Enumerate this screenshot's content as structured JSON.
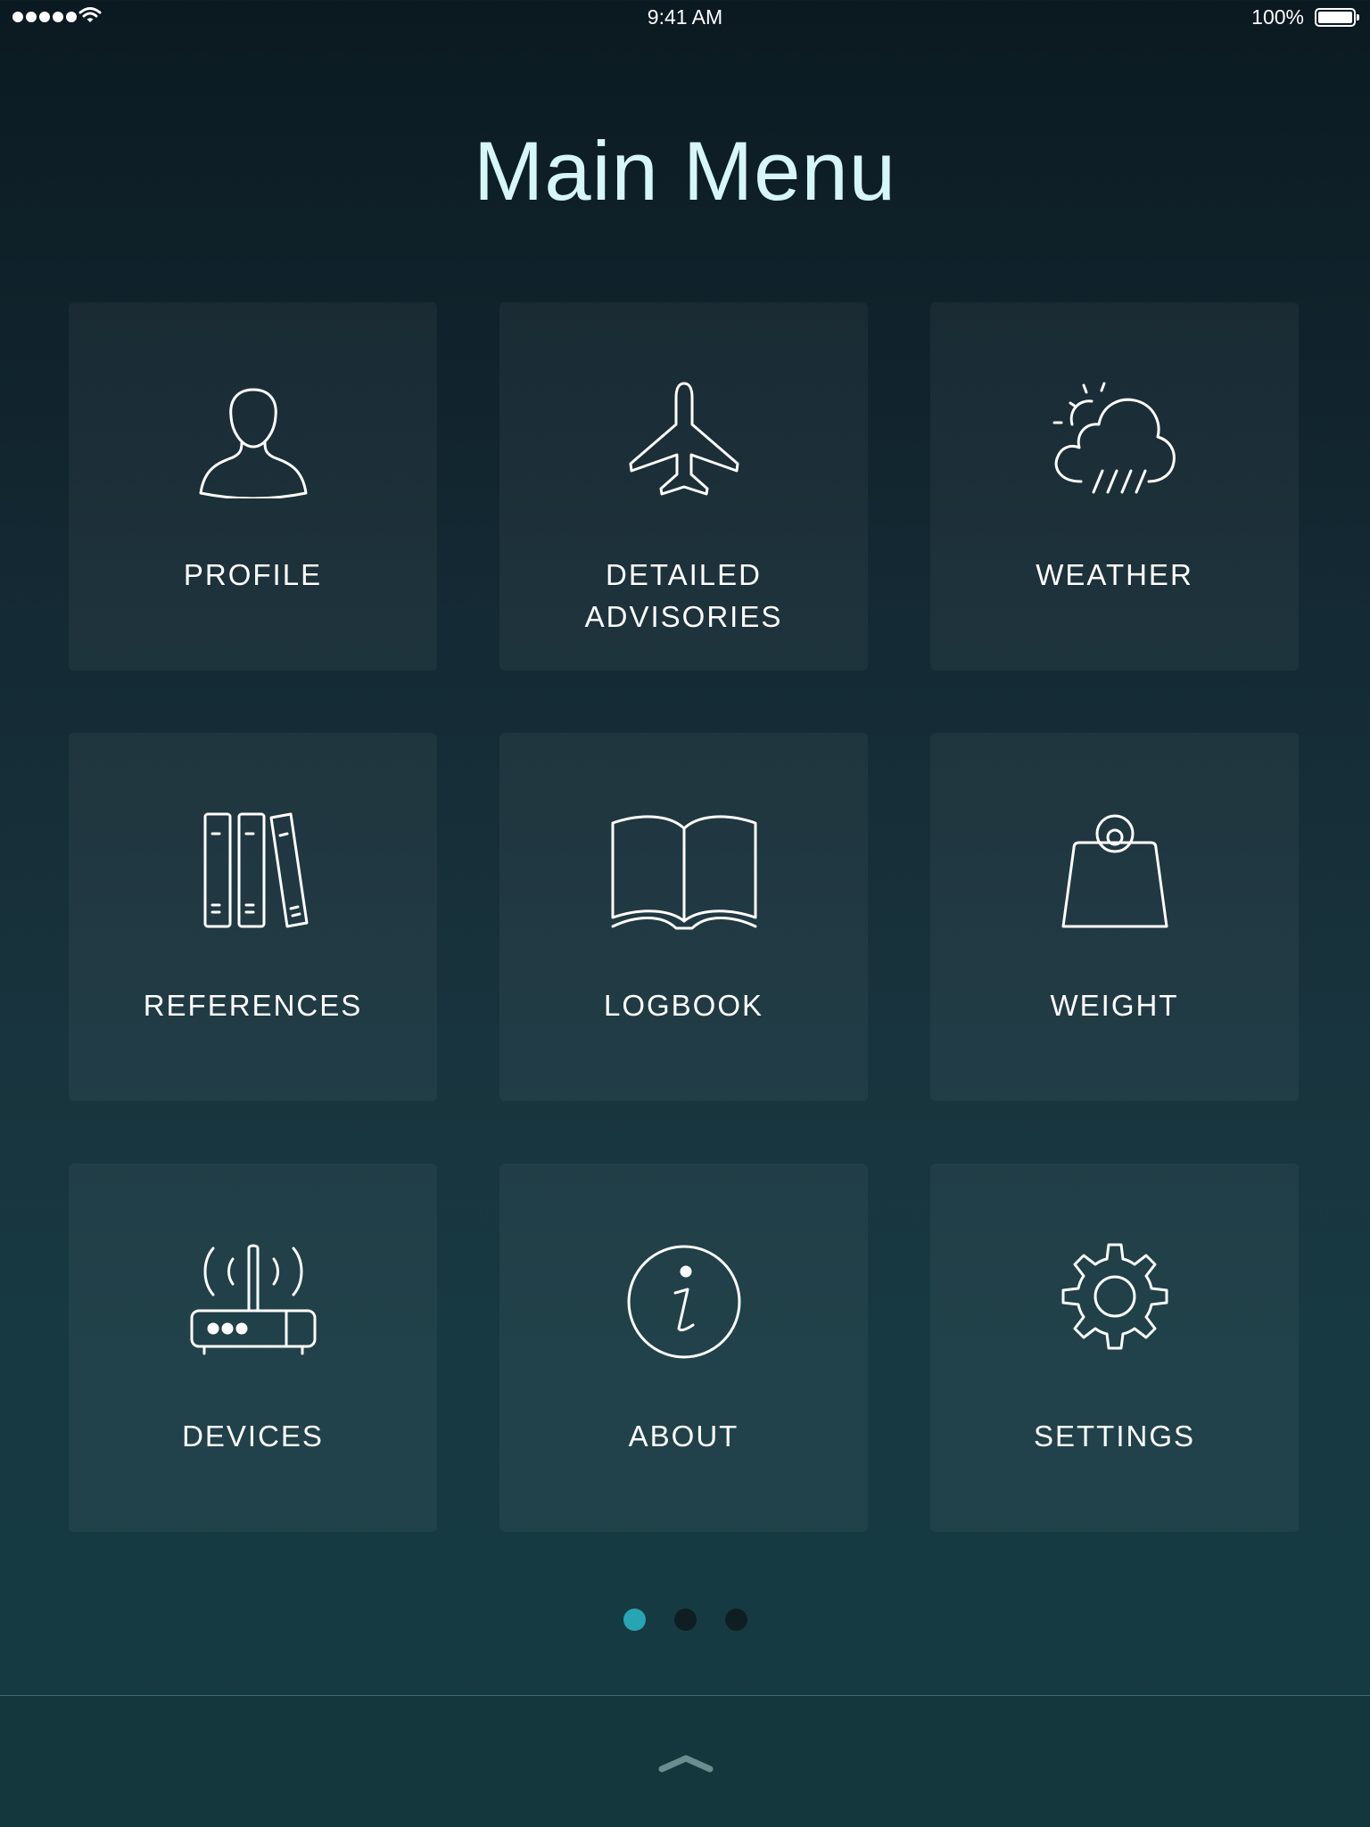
{
  "status_bar": {
    "time": "9:41 AM",
    "battery": "100%",
    "icons": [
      "signal-dots-icon",
      "wifi-icon",
      "battery-icon"
    ]
  },
  "title": "Main Menu",
  "menu": [
    {
      "label": "PROFILE",
      "icon": "person-icon"
    },
    {
      "label": "DETAILED\nADVISORIES",
      "icon": "airplane-icon"
    },
    {
      "label": "WEATHER",
      "icon": "weather-icon"
    },
    {
      "label": "REFERENCES",
      "icon": "books-icon"
    },
    {
      "label": "LOGBOOK",
      "icon": "open-book-icon"
    },
    {
      "label": "WEIGHT",
      "icon": "weight-icon"
    },
    {
      "label": "DEVICES",
      "icon": "router-icon"
    },
    {
      "label": "ABOUT",
      "icon": "info-icon"
    },
    {
      "label": "SETTINGS",
      "icon": "gear-icon"
    }
  ],
  "pager": {
    "pages": 3,
    "current": 1
  },
  "colors": {
    "title": "#d6f6f8",
    "accent": "#27a5b4",
    "bottom_bar": "#13373c"
  }
}
